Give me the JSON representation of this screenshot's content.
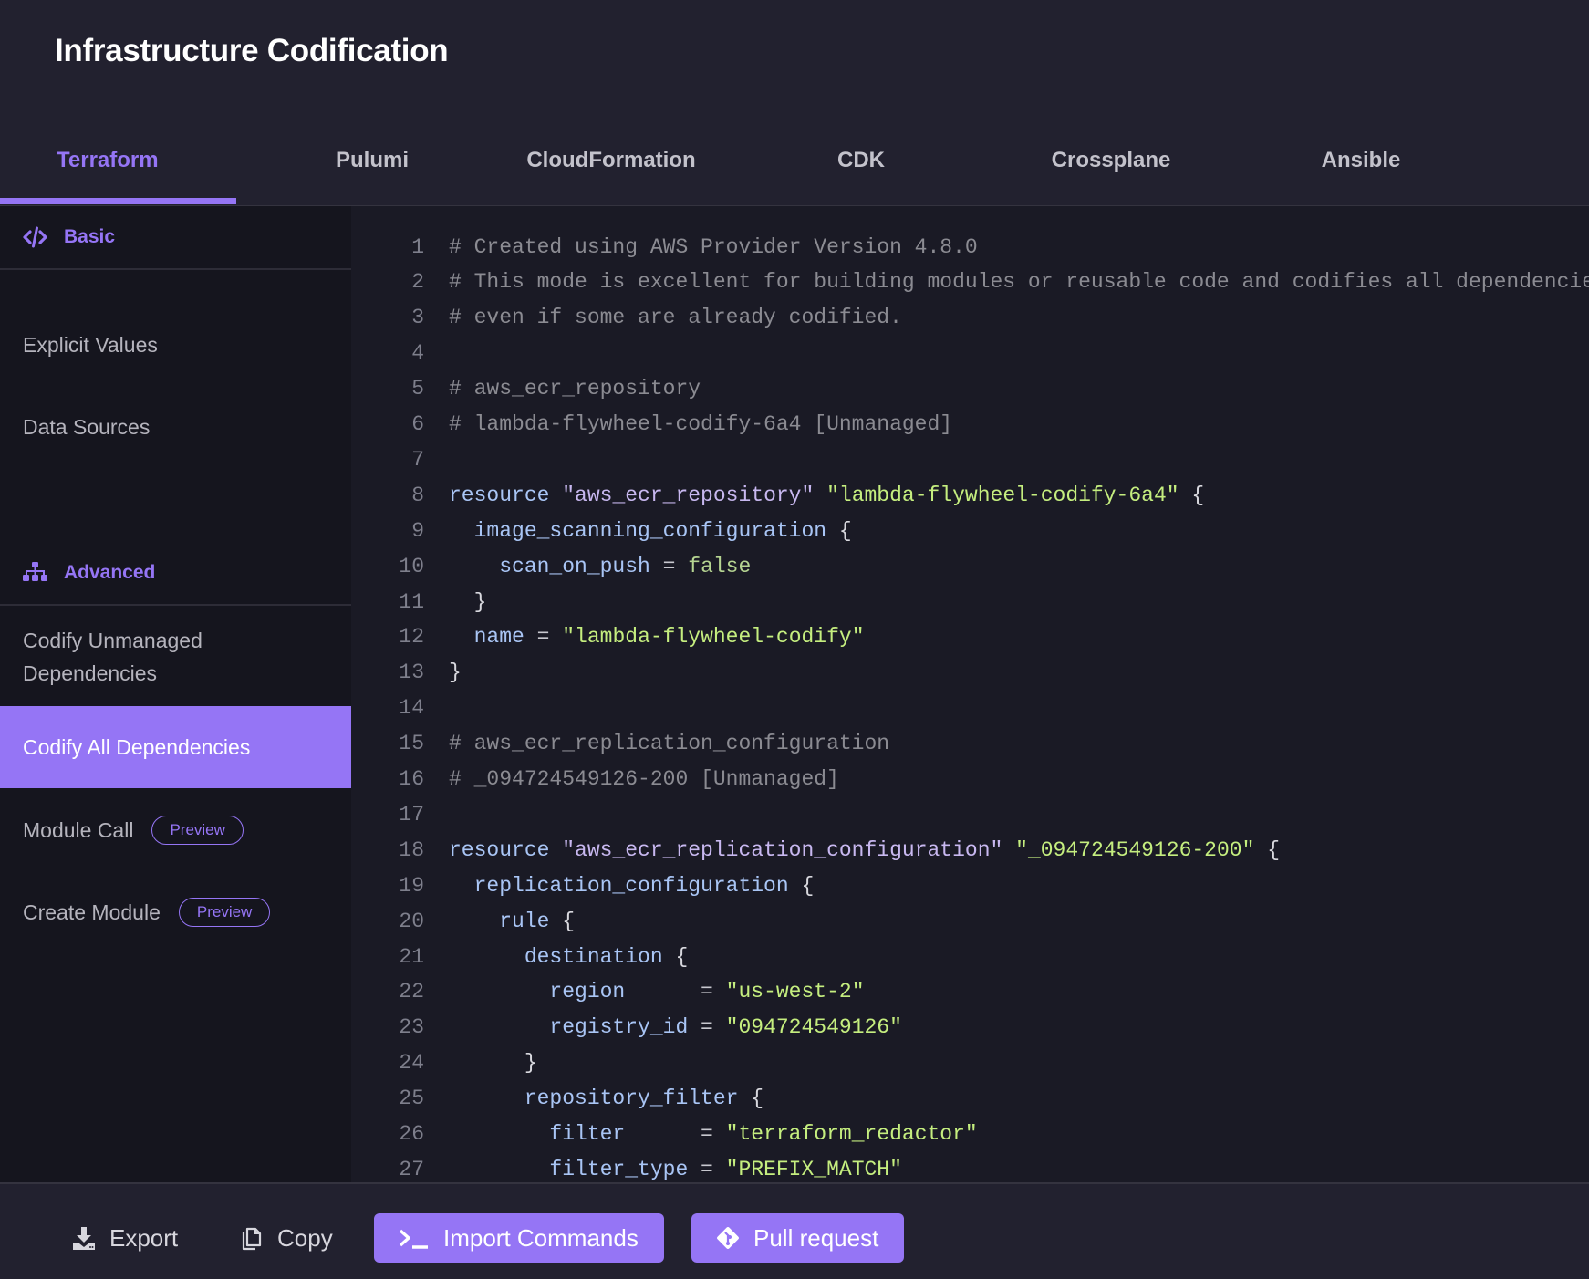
{
  "header": {
    "title": "Infrastructure Codification",
    "tabs": [
      {
        "label": "Terraform",
        "active": true
      },
      {
        "label": "Pulumi",
        "active": false
      },
      {
        "label": "CloudFormation",
        "active": false
      },
      {
        "label": "CDK",
        "active": false
      },
      {
        "label": "Crossplane",
        "active": false
      },
      {
        "label": "Ansible",
        "active": false
      }
    ]
  },
  "sidebar": {
    "basic": {
      "label": "Basic",
      "icon": "code-icon",
      "items": [
        {
          "label": "Explicit Values"
        },
        {
          "label": "Data Sources"
        }
      ]
    },
    "advanced": {
      "label": "Advanced",
      "icon": "sitemap-icon",
      "items": [
        {
          "label": "Codify Unmanaged Dependencies",
          "selected": false
        },
        {
          "label": "Codify All Dependencies",
          "selected": true
        },
        {
          "label": "Module Call",
          "badge": "Preview"
        },
        {
          "label": "Create Module",
          "badge": "Preview"
        }
      ]
    }
  },
  "code": {
    "lines": [
      [
        {
          "t": "cm",
          "v": "# Created using AWS Provider Version 4.8.0"
        }
      ],
      [
        {
          "t": "cm",
          "v": "# This mode is excellent for building modules or reusable code and codifies all dependencies"
        }
      ],
      [
        {
          "t": "cm",
          "v": "# even if some are already codified."
        }
      ],
      [],
      [
        {
          "t": "cm",
          "v": "# aws_ecr_repository"
        }
      ],
      [
        {
          "t": "cm",
          "v": "# lambda-flywheel-codify-6a4 [Unmanaged]"
        }
      ],
      [],
      [
        {
          "t": "kw",
          "v": "resource "
        },
        {
          "t": "ty",
          "v": "\"aws_ecr_repository\""
        },
        {
          "t": "pn",
          "v": " "
        },
        {
          "t": "str",
          "v": "\"lambda-flywheel-codify-6a4\""
        },
        {
          "t": "pn",
          "v": " {"
        }
      ],
      [
        {
          "t": "kw",
          "v": "  image_scanning_configuration"
        },
        {
          "t": "pn",
          "v": " {"
        }
      ],
      [
        {
          "t": "kw",
          "v": "    scan_on_push"
        },
        {
          "t": "op",
          "v": " = "
        },
        {
          "t": "bool",
          "v": "false"
        }
      ],
      [
        {
          "t": "pn",
          "v": "  }"
        }
      ],
      [
        {
          "t": "kw",
          "v": "  name"
        },
        {
          "t": "op",
          "v": " = "
        },
        {
          "t": "str",
          "v": "\"lambda-flywheel-codify\""
        }
      ],
      [
        {
          "t": "pn",
          "v": "}"
        }
      ],
      [],
      [
        {
          "t": "cm",
          "v": "# aws_ecr_replication_configuration"
        }
      ],
      [
        {
          "t": "cm",
          "v": "# _094724549126-200 [Unmanaged]"
        }
      ],
      [],
      [
        {
          "t": "kw",
          "v": "resource "
        },
        {
          "t": "ty",
          "v": "\"aws_ecr_replication_configuration\""
        },
        {
          "t": "pn",
          "v": " "
        },
        {
          "t": "str",
          "v": "\"_094724549126-200\""
        },
        {
          "t": "pn",
          "v": " {"
        }
      ],
      [
        {
          "t": "kw",
          "v": "  replication_configuration"
        },
        {
          "t": "pn",
          "v": " {"
        }
      ],
      [
        {
          "t": "kw",
          "v": "    rule"
        },
        {
          "t": "pn",
          "v": " {"
        }
      ],
      [
        {
          "t": "kw",
          "v": "      destination"
        },
        {
          "t": "pn",
          "v": " {"
        }
      ],
      [
        {
          "t": "kw",
          "v": "        region     "
        },
        {
          "t": "op",
          "v": " = "
        },
        {
          "t": "str",
          "v": "\"us-west-2\""
        }
      ],
      [
        {
          "t": "kw",
          "v": "        registry_id"
        },
        {
          "t": "op",
          "v": " = "
        },
        {
          "t": "str",
          "v": "\"094724549126\""
        }
      ],
      [
        {
          "t": "pn",
          "v": "      }"
        }
      ],
      [
        {
          "t": "kw",
          "v": "      repository_filter"
        },
        {
          "t": "pn",
          "v": " {"
        }
      ],
      [
        {
          "t": "kw",
          "v": "        filter     "
        },
        {
          "t": "op",
          "v": " = "
        },
        {
          "t": "str",
          "v": "\"terraform_redactor\""
        }
      ],
      [
        {
          "t": "kw",
          "v": "        filter_type"
        },
        {
          "t": "op",
          "v": " = "
        },
        {
          "t": "str",
          "v": "\"PREFIX_MATCH\""
        }
      ]
    ]
  },
  "footer": {
    "export_label": "Export",
    "copy_label": "Copy",
    "import_label": "Import Commands",
    "pull_request_label": "Pull request"
  },
  "colors": {
    "accent": "#9575f5",
    "header_bg": "#22212f",
    "sidebar_bg": "#15151e",
    "code_bg": "#1a1a25",
    "string": "#c5ee7f",
    "keyword": "#a9c5f5",
    "comment": "#8b8b92"
  }
}
